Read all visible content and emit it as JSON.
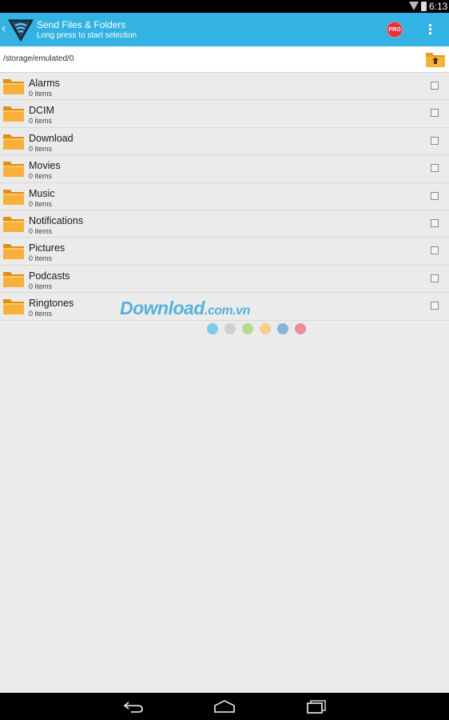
{
  "status_bar": {
    "time": "6:13",
    "wifi_icon": "wifi-icon",
    "battery_icon": "battery-icon"
  },
  "action_bar": {
    "title": "Send Files & Folders",
    "subtitle": "Long press to start selection",
    "pro_badge": "PRO",
    "accent_color": "#33b3e3"
  },
  "path_bar": {
    "path": "/storage/emulated/0",
    "up_icon": "folder-up-icon"
  },
  "folders": [
    {
      "name": "Alarms",
      "count": "0 items"
    },
    {
      "name": "DCIM",
      "count": "0 items"
    },
    {
      "name": "Download",
      "count": "0 items"
    },
    {
      "name": "Movies",
      "count": "0 items"
    },
    {
      "name": "Music",
      "count": "0 items"
    },
    {
      "name": "Notifications",
      "count": "0 items"
    },
    {
      "name": "Pictures",
      "count": "0 items"
    },
    {
      "name": "Podcasts",
      "count": "0 items"
    },
    {
      "name": "Ringtones",
      "count": "0 items"
    }
  ],
  "watermark": {
    "text": "Download",
    "suffix": ".com.vn",
    "dot_colors": [
      "#7fcbee",
      "#d0d0d0",
      "#b5dc8e",
      "#f6cf8d",
      "#86b4d9",
      "#ee8d95"
    ]
  },
  "nav_bar": {
    "back_icon": "back-icon",
    "home_icon": "home-icon",
    "recents_icon": "recents-icon"
  }
}
